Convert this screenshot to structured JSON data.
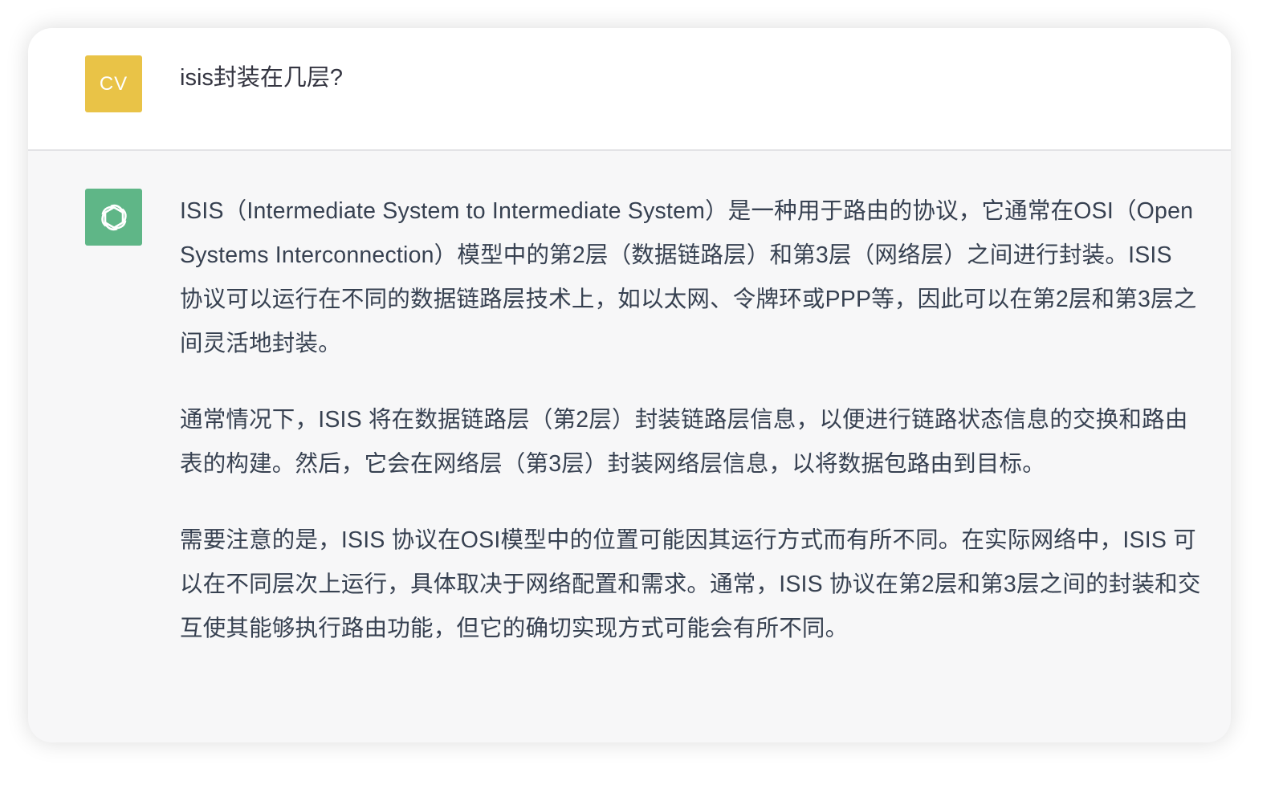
{
  "colors": {
    "user_avatar_bg": "#e9c347",
    "bot_avatar_bg": "#5fb687"
  },
  "user": {
    "avatar_initials": "CV",
    "message": "isis封装在几层?"
  },
  "assistant": {
    "avatar_icon": "openai-logo-icon",
    "paragraphs": [
      "ISIS（Intermediate System to Intermediate System）是一种用于路由的协议，它通常在OSI（Open Systems Interconnection）模型中的第2层（数据链路层）和第3层（网络层）之间进行封装。ISIS 协议可以运行在不同的数据链路层技术上，如以太网、令牌环或PPP等，因此可以在第2层和第3层之间灵活地封装。",
      "通常情况下，ISIS 将在数据链路层（第2层）封装链路层信息，以便进行链路状态信息的交换和路由表的构建。然后，它会在网络层（第3层）封装网络层信息，以将数据包路由到目标。",
      "需要注意的是，ISIS 协议在OSI模型中的位置可能因其运行方式而有所不同。在实际网络中，ISIS 可以在不同层次上运行，具体取决于网络配置和需求。通常，ISIS 协议在第2层和第3层之间的封装和交互使其能够执行路由功能，但它的确切实现方式可能会有所不同。"
    ]
  }
}
